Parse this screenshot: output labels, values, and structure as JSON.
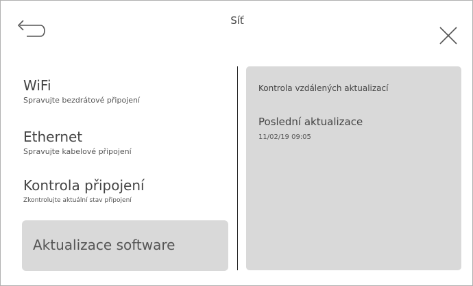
{
  "header": {
    "title": "Síť",
    "back_icon": "back-arrow-icon",
    "close_icon": "close-icon"
  },
  "menu": {
    "items": [
      {
        "label": "WiFi",
        "subtitle": "Spravujte bezdrátové připojení"
      },
      {
        "label": "Ethernet",
        "subtitle": "Spravujte kabelové připojení"
      },
      {
        "label": "Kontrola připojení",
        "subtitle": "Zkontrolujte aktuální stav připojení"
      },
      {
        "label": "Aktualizace software",
        "selected": true
      }
    ]
  },
  "panel": {
    "remote_check_label": "Kontrola vzdálených aktualizací",
    "last_update_title": "Poslední aktualizace",
    "last_update_value": "11/02/19 09:05"
  },
  "colors": {
    "background": "#ffffff",
    "selected_bg": "#d9d9d9",
    "panel_bg": "#d9d9d9",
    "text": "#444444"
  }
}
